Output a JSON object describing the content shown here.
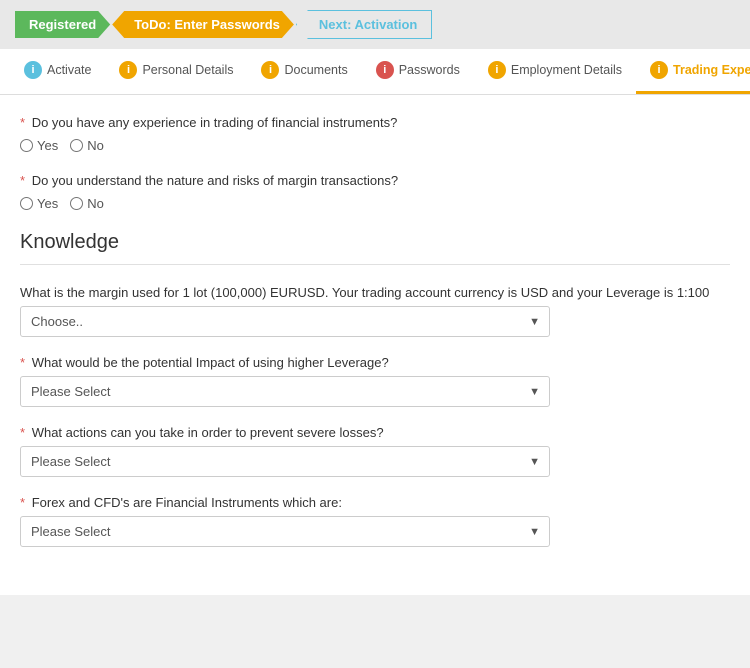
{
  "progress": {
    "steps": [
      {
        "id": "registered",
        "label": "Registered",
        "class": "step-registered"
      },
      {
        "id": "todo",
        "label": "ToDo: Enter Passwords",
        "class": "step-todo"
      },
      {
        "id": "next",
        "label": "Next: Activation",
        "class": "step-next"
      }
    ]
  },
  "tabs": [
    {
      "id": "activate",
      "label": "Activate",
      "icon": "i",
      "icon_class": "icon-blue",
      "active": false
    },
    {
      "id": "personal-details",
      "label": "Personal Details",
      "icon": "i",
      "icon_class": "icon-orange",
      "active": false
    },
    {
      "id": "documents",
      "label": "Documents",
      "icon": "i",
      "icon_class": "icon-orange",
      "active": false
    },
    {
      "id": "passwords",
      "label": "Passwords",
      "icon": "i",
      "icon_class": "icon-red",
      "active": false
    },
    {
      "id": "employment-details",
      "label": "Employment Details",
      "icon": "i",
      "icon_class": "icon-orange",
      "active": false
    },
    {
      "id": "trading-experience",
      "label": "Trading Experience",
      "icon": "i",
      "icon_class": "icon-orange",
      "active": true
    }
  ],
  "questions": {
    "q1": {
      "label": "Do you have any experience in trading of financial instruments?",
      "required": true,
      "options": [
        "Yes",
        "No"
      ]
    },
    "q2": {
      "label": "Do you understand the nature and risks of margin transactions?",
      "required": true,
      "options": [
        "Yes",
        "No"
      ]
    }
  },
  "knowledge": {
    "section_title": "Knowledge",
    "questions": [
      {
        "id": "margin-question",
        "label": "What is the margin used for 1 lot (100,000) EURUSD. Your trading account currency is USD and your Leverage is 1:100",
        "required": false,
        "default": "Choose.."
      },
      {
        "id": "leverage-impact",
        "label": "What would be the potential Impact of using higher Leverage?",
        "required": true,
        "default": "Please Select"
      },
      {
        "id": "prevent-losses",
        "label": "What actions can you take in order to prevent severe losses?",
        "required": true,
        "default": "Please Select"
      },
      {
        "id": "forex-cfds",
        "label": "Forex and CFD's are Financial Instruments which are:",
        "required": true,
        "default": "Please Select"
      }
    ]
  }
}
